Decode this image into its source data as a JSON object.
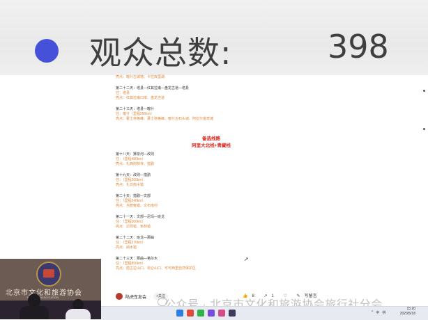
{
  "banner": {
    "label": "观众总数:",
    "value": "398"
  },
  "document": {
    "lines": [
      {
        "kind": "detail",
        "text": "亮点：喀什古城墙、卡拉库里湖"
      },
      {
        "kind": "gap"
      },
      {
        "kind": "title",
        "text": "第二十二天：塔县—红其拉甫—盘龙古道—塔县"
      },
      {
        "kind": "detail",
        "text": "住：塔县"
      },
      {
        "kind": "detail",
        "text": "亮点：红其拉甫口岸、盘龙古道"
      },
      {
        "kind": "gap"
      },
      {
        "kind": "title",
        "text": "第二十三天：塔县—喀什"
      },
      {
        "kind": "detail",
        "text": "住：喀什（里程290km）"
      },
      {
        "kind": "detail",
        "text": "亮点：霍士塔格峰、慕士塔格峰、喀什古石头城、阿拉尔金草滩"
      }
    ],
    "routes_heading": "备选线路",
    "routes_subheading": "阿里大北线+青藏线",
    "lines2": [
      {
        "kind": "title",
        "text": "第十八天：狮泉河—改则"
      },
      {
        "kind": "detail",
        "text": "住：（里程480km）"
      },
      {
        "kind": "detail",
        "text": "亮点：扎西岗林寺、措勤"
      },
      {
        "kind": "gap"
      },
      {
        "kind": "title",
        "text": "第十九天：改则—措勤"
      },
      {
        "kind": "detail",
        "text": "住：（里程260km）"
      },
      {
        "kind": "detail",
        "text": "亮点：扎日南木错"
      },
      {
        "kind": "gap"
      },
      {
        "kind": "title",
        "text": "第二十天：措勤—文部"
      },
      {
        "kind": "detail",
        "text": "住：（里程240km）"
      },
      {
        "kind": "detail",
        "text": "亮点：当惹雍错、文布南村"
      },
      {
        "kind": "gap"
      },
      {
        "kind": "title",
        "text": "第二十一天：文部—尼玛—班戈"
      },
      {
        "kind": "detail",
        "text": "住：（里程300km）"
      },
      {
        "kind": "detail",
        "text": "亮点：达则错、色林错"
      },
      {
        "kind": "gap"
      },
      {
        "kind": "title",
        "text": "第二十二天：班戈—那曲"
      },
      {
        "kind": "detail",
        "text": "住：（里程270km）"
      },
      {
        "kind": "detail",
        "text": "亮点：纳木错"
      },
      {
        "kind": "gap"
      },
      {
        "kind": "title",
        "text": "第二十三天：那曲—格尔木"
      },
      {
        "kind": "detail",
        "text": "住：（里程850km）"
      },
      {
        "kind": "detail",
        "text": "亮点：唐古拉山口、昆仑山口、可可西里自然保护区"
      }
    ]
  },
  "author": {
    "name": "陆虎车友会",
    "follow_label": "+关注"
  },
  "actions": {
    "like_count": "8",
    "share_count": "1",
    "comment_label": "写留言"
  },
  "webcam": {
    "caption": "北京市文化和旅游协会",
    "sub": "TOURISM ASSOCIATION"
  },
  "watermark": "公众号 · 北京市文化和旅游协会旅行社分会",
  "taskbar": {
    "tray": [
      "^",
      "中",
      "拼"
    ],
    "time": "15:20",
    "date": "2023/5/18"
  },
  "colors": {
    "accent_red": "#d8261e",
    "detail_orange": "#e08a3c",
    "banner_dot": "#4451d8"
  }
}
